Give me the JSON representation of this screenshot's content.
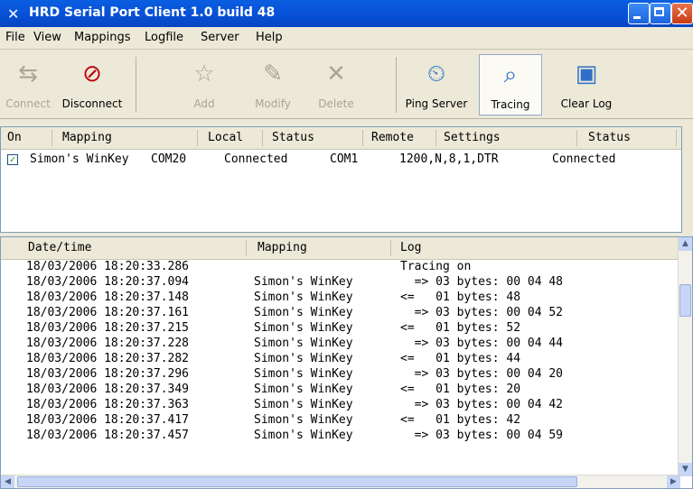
{
  "window": {
    "title": "HRD Serial Port Client 1.0 build 48"
  },
  "menu": [
    "File",
    "View",
    "Mappings",
    "Logfile",
    "Server",
    "Help"
  ],
  "toolbar": {
    "connect": "Connect",
    "disconnect": "Disconnect",
    "add": "Add",
    "modify": "Modify",
    "delete": "Delete",
    "ping_server": "Ping Server",
    "tracing": "Tracing",
    "clear_log": "Clear Log"
  },
  "mapping_list": {
    "headers": [
      "On",
      "Mapping",
      "Local",
      "Status",
      "Remote",
      "Settings",
      "Status"
    ],
    "rows": [
      {
        "on": true,
        "mapping": "Simon's WinKey",
        "local": "COM20",
        "status": "Connected",
        "remote": "COM1",
        "settings": "1200,N,8,1,DTR",
        "remote_status": "Connected"
      }
    ]
  },
  "log": {
    "headers": [
      "Date/time",
      "Mapping",
      "Log"
    ],
    "rows": [
      [
        "18/03/2006 18:20:33.286",
        "",
        "Tracing on"
      ],
      [
        "18/03/2006 18:20:37.094",
        "Simon's WinKey",
        "  => 03 bytes: 00 04 48"
      ],
      [
        "18/03/2006 18:20:37.148",
        "Simon's WinKey",
        "<=   01 bytes: 48"
      ],
      [
        "18/03/2006 18:20:37.161",
        "Simon's WinKey",
        "  => 03 bytes: 00 04 52"
      ],
      [
        "18/03/2006 18:20:37.215",
        "Simon's WinKey",
        "<=   01 bytes: 52"
      ],
      [
        "18/03/2006 18:20:37.228",
        "Simon's WinKey",
        "  => 03 bytes: 00 04 44"
      ],
      [
        "18/03/2006 18:20:37.282",
        "Simon's WinKey",
        "<=   01 bytes: 44"
      ],
      [
        "18/03/2006 18:20:37.296",
        "Simon's WinKey",
        "  => 03 bytes: 00 04 20"
      ],
      [
        "18/03/2006 18:20:37.349",
        "Simon's WinKey",
        "<=   01 bytes: 20"
      ],
      [
        "18/03/2006 18:20:37.363",
        "Simon's WinKey",
        "  => 03 bytes: 00 04 42"
      ],
      [
        "18/03/2006 18:20:37.417",
        "Simon's WinKey",
        "<=   01 bytes: 42"
      ],
      [
        "18/03/2006 18:20:37.457",
        "Simon's WinKey",
        "  => 03 bytes: 00 04 59"
      ]
    ]
  },
  "colors": {
    "titlebar": "#0a5ee0",
    "face": "#ece9d8",
    "check": "#21a121"
  }
}
